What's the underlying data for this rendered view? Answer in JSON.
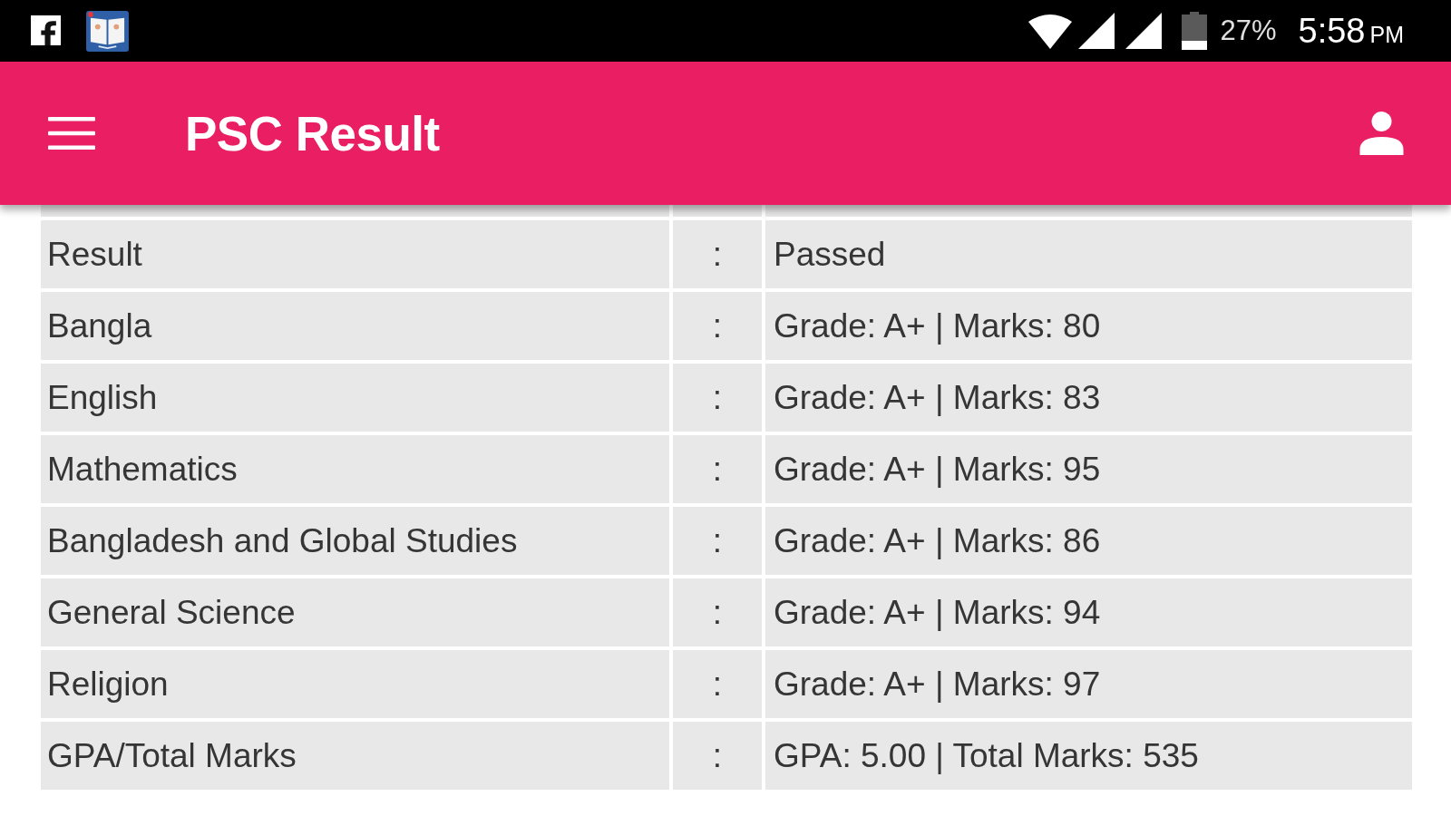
{
  "status_bar": {
    "battery": "27%",
    "time": "5:58",
    "period": "PM"
  },
  "app_bar": {
    "title": "PSC Result"
  },
  "table": {
    "rows": [
      {
        "label": "Result",
        "separator": ":",
        "value": "Passed"
      },
      {
        "label": "Bangla",
        "separator": ":",
        "value": "Grade: A+ | Marks: 80"
      },
      {
        "label": "English",
        "separator": ":",
        "value": "Grade: A+ | Marks: 83"
      },
      {
        "label": "Mathematics",
        "separator": ":",
        "value": "Grade: A+ | Marks: 95"
      },
      {
        "label": "Bangladesh and Global Studies",
        "separator": ":",
        "value": "Grade: A+ | Marks: 86"
      },
      {
        "label": "General Science",
        "separator": ":",
        "value": "Grade: A+ | Marks: 94"
      },
      {
        "label": "Religion",
        "separator": ":",
        "value": "Grade: A+ | Marks: 97"
      },
      {
        "label": "GPA/Total Marks",
        "separator": ":",
        "value": "GPA: 5.00 | Total Marks: 535"
      }
    ]
  }
}
